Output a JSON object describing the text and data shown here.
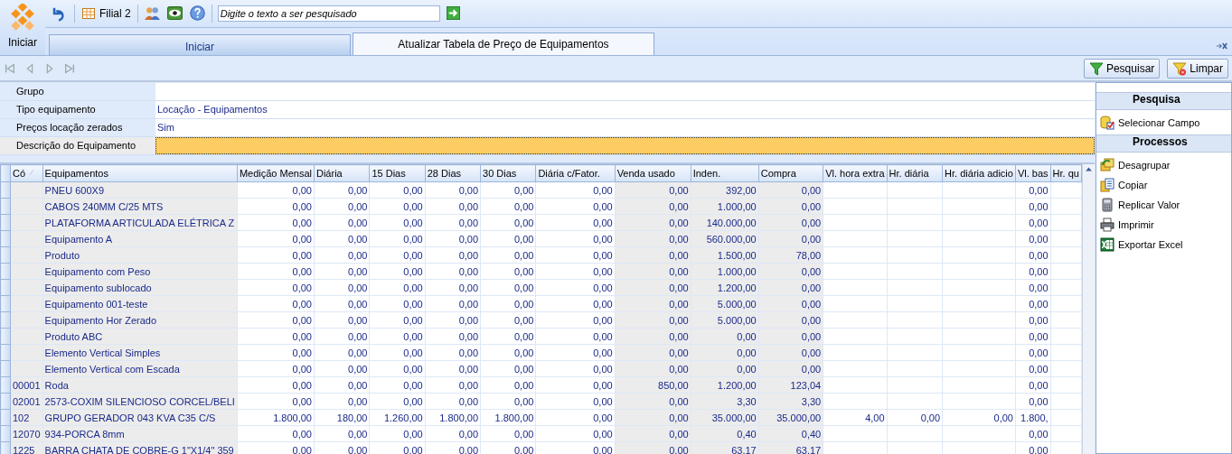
{
  "app_button": {
    "label": "Iniciar"
  },
  "toolbar": {
    "branch": "Filial 2",
    "search": {
      "placeholder": "Digite o texto a ser pesquisado"
    }
  },
  "tabs": [
    {
      "label": "Iniciar",
      "selected": false
    },
    {
      "label": "Atualizar Tabela de Preço de Equipamentos",
      "selected": true
    }
  ],
  "actions": [
    {
      "kind": "search",
      "label": "Pesquisar"
    },
    {
      "kind": "clear",
      "label": "Limpar"
    }
  ],
  "filters": [
    {
      "label": "Grupo",
      "selected": false
    },
    {
      "label": "Tipo equipamento",
      "value": "Locação - Equipamentos",
      "selected": false
    },
    {
      "label": "Preços locação zerados",
      "value": "Sim",
      "selected": false
    },
    {
      "label": "Descrição do Equipamento",
      "selected": true
    }
  ],
  "table": {
    "columns": [
      {
        "label": "Có",
        "shaded": true,
        "sorted": true
      },
      {
        "label": "Equipamentos",
        "shaded": true,
        "sorted": false
      },
      {
        "label": "Medição Mensal",
        "shaded": false,
        "sorted": false
      },
      {
        "label": "Diária",
        "shaded": false,
        "sorted": false
      },
      {
        "label": "15 Dias",
        "shaded": false,
        "sorted": false
      },
      {
        "label": "28 Dias",
        "shaded": false,
        "sorted": false
      },
      {
        "label": "30 Dias",
        "shaded": false,
        "sorted": false
      },
      {
        "label": "Diária c/Fator.",
        "shaded": false,
        "sorted": false
      },
      {
        "label": "Venda usado",
        "shaded": true,
        "sorted": false
      },
      {
        "label": "Inden.",
        "shaded": true,
        "sorted": false
      },
      {
        "label": "Compra",
        "shaded": true,
        "sorted": false
      },
      {
        "label": "Vl. hora extra",
        "shaded": false,
        "sorted": false
      },
      {
        "label": "Hr. diária",
        "shaded": false,
        "sorted": false
      },
      {
        "label": "Hr. diária adicio",
        "shaded": false,
        "sorted": false
      },
      {
        "label": "Vl. bas",
        "shaded": false,
        "sorted": false
      },
      {
        "label": "Hr. qu",
        "shaded": false,
        "sorted": false
      }
    ],
    "rows": [
      {
        "cells": [
          "",
          "PNEU 600X9",
          "0,00",
          "0,00",
          "0,00",
          "0,00",
          "0,00",
          "0,00",
          "0,00",
          "392,00",
          "0,00",
          "",
          "",
          "",
          "0,00",
          ""
        ]
      },
      {
        "cells": [
          "",
          "CABOS 240MM C/25 MTS",
          "0,00",
          "0,00",
          "0,00",
          "0,00",
          "0,00",
          "0,00",
          "0,00",
          "1.000,00",
          "0,00",
          "",
          "",
          "",
          "0,00",
          ""
        ]
      },
      {
        "cells": [
          "",
          "PLATAFORMA ARTICULADA ELÉTRICA Z",
          "0,00",
          "0,00",
          "0,00",
          "0,00",
          "0,00",
          "0,00",
          "0,00",
          "140.000,00",
          "0,00",
          "",
          "",
          "",
          "0,00",
          ""
        ]
      },
      {
        "cells": [
          "",
          "Equipamento A",
          "0,00",
          "0,00",
          "0,00",
          "0,00",
          "0,00",
          "0,00",
          "0,00",
          "560.000,00",
          "0,00",
          "",
          "",
          "",
          "0,00",
          ""
        ]
      },
      {
        "cells": [
          "",
          "Produto",
          "0,00",
          "0,00",
          "0,00",
          "0,00",
          "0,00",
          "0,00",
          "0,00",
          "1.500,00",
          "78,00",
          "",
          "",
          "",
          "0,00",
          ""
        ]
      },
      {
        "cells": [
          "",
          "Equipamento com Peso",
          "0,00",
          "0,00",
          "0,00",
          "0,00",
          "0,00",
          "0,00",
          "0,00",
          "1.000,00",
          "0,00",
          "",
          "",
          "",
          "0,00",
          ""
        ]
      },
      {
        "cells": [
          "",
          "Equipamento sublocado",
          "0,00",
          "0,00",
          "0,00",
          "0,00",
          "0,00",
          "0,00",
          "0,00",
          "1.200,00",
          "0,00",
          "",
          "",
          "",
          "0,00",
          ""
        ]
      },
      {
        "cells": [
          "",
          "Equipamento 001-teste",
          "0,00",
          "0,00",
          "0,00",
          "0,00",
          "0,00",
          "0,00",
          "0,00",
          "5.000,00",
          "0,00",
          "",
          "",
          "",
          "0,00",
          ""
        ]
      },
      {
        "cells": [
          "",
          "Equipamento Hor Zerado",
          "0,00",
          "0,00",
          "0,00",
          "0,00",
          "0,00",
          "0,00",
          "0,00",
          "5.000,00",
          "0,00",
          "",
          "",
          "",
          "0,00",
          ""
        ]
      },
      {
        "cells": [
          "",
          "Produto ABC",
          "0,00",
          "0,00",
          "0,00",
          "0,00",
          "0,00",
          "0,00",
          "0,00",
          "0,00",
          "0,00",
          "",
          "",
          "",
          "0,00",
          ""
        ]
      },
      {
        "cells": [
          "",
          "Elemento Vertical Simples",
          "0,00",
          "0,00",
          "0,00",
          "0,00",
          "0,00",
          "0,00",
          "0,00",
          "0,00",
          "0,00",
          "",
          "",
          "",
          "0,00",
          ""
        ]
      },
      {
        "cells": [
          "",
          "Elemento Vertical com Escada",
          "0,00",
          "0,00",
          "0,00",
          "0,00",
          "0,00",
          "0,00",
          "0,00",
          "0,00",
          "0,00",
          "",
          "",
          "",
          "0,00",
          ""
        ]
      },
      {
        "cells": [
          "00001",
          "Roda",
          "0,00",
          "0,00",
          "0,00",
          "0,00",
          "0,00",
          "0,00",
          "850,00",
          "1.200,00",
          "123,04",
          "",
          "",
          "",
          "0,00",
          ""
        ]
      },
      {
        "cells": [
          "02001",
          "2573-COXIM SILENCIOSO CORCEL/BELI",
          "0,00",
          "0,00",
          "0,00",
          "0,00",
          "0,00",
          "0,00",
          "0,00",
          "3,30",
          "3,30",
          "",
          "",
          "",
          "0,00",
          ""
        ]
      },
      {
        "cells": [
          "102",
          "GRUPO GERADOR 043 KVA C35 C/S",
          "1.800,00",
          "180,00",
          "1.260,00",
          "1.800,00",
          "1.800,00",
          "0,00",
          "0,00",
          "35.000,00",
          "35.000,00",
          "4,00",
          "0,00",
          "0,00",
          "1.800,",
          ""
        ]
      },
      {
        "cells": [
          "12070",
          "934-PORCA 8mm",
          "0,00",
          "0,00",
          "0,00",
          "0,00",
          "0,00",
          "0,00",
          "0,00",
          "0,40",
          "0,40",
          "",
          "",
          "",
          "0,00",
          ""
        ]
      },
      {
        "cells": [
          "1225",
          "BARRA CHATA DE COBRE-G 1\"X1/4\" 359",
          "0,00",
          "0,00",
          "0,00",
          "0,00",
          "0,00",
          "0,00",
          "0,00",
          "63,17",
          "63,17",
          "",
          "",
          "",
          "0,00",
          ""
        ]
      }
    ]
  },
  "side_panel": {
    "sections": [
      {
        "title": "Pesquisa",
        "items": [
          {
            "kind": "select-field",
            "label": "Selecionar Campo"
          }
        ]
      },
      {
        "title": "Processos",
        "items": [
          {
            "kind": "ungroup",
            "label": "Desagrupar"
          },
          {
            "kind": "copy",
            "label": "Copiar"
          },
          {
            "kind": "replicate",
            "label": "Replicar Valor"
          },
          {
            "kind": "print",
            "label": "Imprimir"
          },
          {
            "kind": "excel",
            "label": "Exportar Excel"
          }
        ]
      }
    ]
  }
}
